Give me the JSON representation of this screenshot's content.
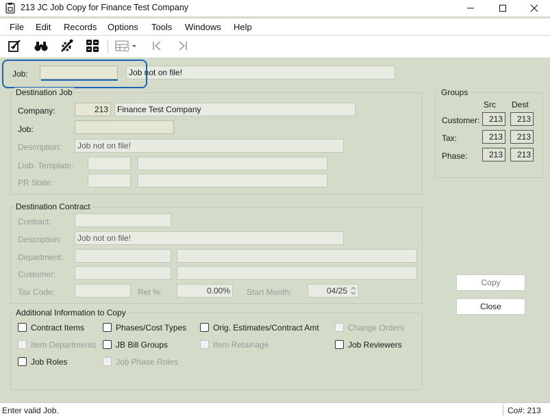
{
  "window": {
    "title": "213 JC Job Copy for Finance Test Company"
  },
  "menu": [
    "File",
    "Edit",
    "Records",
    "Options",
    "Tools",
    "Windows",
    "Help"
  ],
  "job": {
    "label": "Job:",
    "value": "",
    "status": "Job not on file!"
  },
  "destination_job": {
    "title": "Destination Job",
    "company_label": "Company:",
    "company_value": "213",
    "company_name": "Finance Test Company",
    "job_label": "Job:",
    "job_value": "",
    "description_label": "Description:",
    "description_value": "Job not on file!",
    "liab_template_label": "Liab. Template:",
    "liab_template_value": "",
    "liab_template_desc": "",
    "pr_state_label": "PR State:",
    "pr_state_value": "",
    "pr_state_desc": ""
  },
  "destination_contract": {
    "title": "Destination Contract",
    "contract_label": "Contract:",
    "contract_value": "",
    "description_label": "Description:",
    "description_value": "Job not on file!",
    "department_label": "Department:",
    "department_value": "",
    "department_desc": "",
    "customer_label": "Customer:",
    "customer_value": "",
    "customer_desc": "",
    "tax_code_label": "Tax Code:",
    "tax_code_value": "",
    "ret_label": "Ret %:",
    "ret_value": "0.00%",
    "start_month_label": "Start Month:",
    "start_month_value": "04/25"
  },
  "groups": {
    "title": "Groups",
    "src_header": "Src",
    "dest_header": "Dest",
    "rows": [
      {
        "label": "Customer:",
        "src": "213",
        "dest": "213"
      },
      {
        "label": "Tax:",
        "src": "213",
        "dest": "213"
      },
      {
        "label": "Phase:",
        "src": "213",
        "dest": "213"
      }
    ]
  },
  "additional": {
    "title": "Additional Information to Copy",
    "contract_items": "Contract Items",
    "phases_cost_types": "Phases/Cost Types",
    "orig_estimates": "Orig. Estimates/Contract Amt",
    "change_orders": "Change Orders",
    "item_departments": "Item Departments",
    "jb_bill_groups": "JB Bill Groups",
    "item_retainage": "Item Retainage",
    "job_reviewers": "Job Reviewers",
    "job_roles": "Job Roles",
    "job_phase_roles": "Job Phase Roles"
  },
  "buttons": {
    "copy": "Copy",
    "close": "Close"
  },
  "status": {
    "message": "Enter valid Job.",
    "company": "Co#: 213"
  },
  "icons": {
    "app": "job-copy-app-icon",
    "minimize": "minimize-icon",
    "maximize": "maximize-icon",
    "close": "close-icon",
    "new": "edit-record-icon",
    "find": "binoculars-icon",
    "tools": "wrench-gear-icon",
    "grid": "grid-icon",
    "view": "view-table-icon",
    "first": "first-record-icon",
    "last": "last-record-icon"
  },
  "colors": {
    "form_bg": "#d4dbc8",
    "focus_ring": "#1a63b8",
    "key_field": "#e6e7d3"
  }
}
